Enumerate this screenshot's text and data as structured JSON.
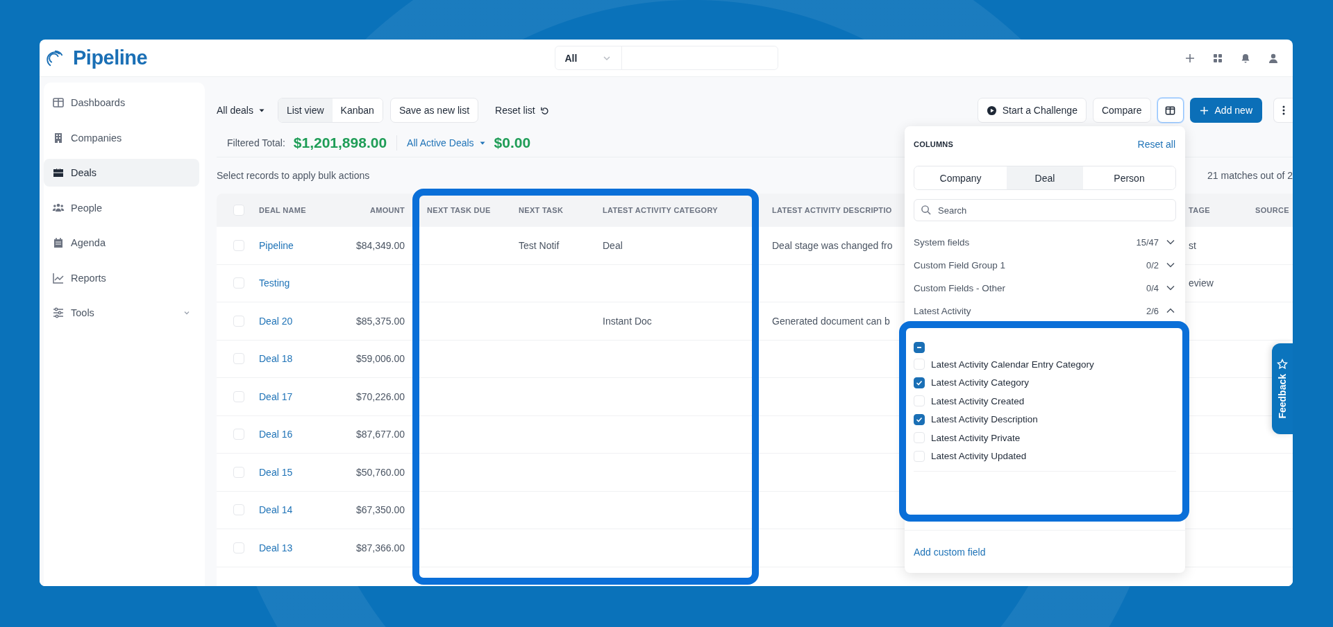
{
  "header": {
    "logo": "Pipeline",
    "search": {
      "scope": "All"
    }
  },
  "sidebar": {
    "items": [
      {
        "label": "Dashboards",
        "selected": false
      },
      {
        "label": "Companies",
        "selected": false
      },
      {
        "label": "Deals",
        "selected": true
      },
      {
        "label": "People",
        "selected": false
      },
      {
        "label": "Agenda",
        "selected": false
      },
      {
        "label": "Reports",
        "selected": false
      },
      {
        "label": "Tools",
        "selected": false,
        "expanded": false
      }
    ]
  },
  "toolbar": {
    "list_menu": "All deals",
    "views": [
      {
        "label": "List view",
        "selected": true
      },
      {
        "label": "Kanban",
        "selected": false
      }
    ],
    "save_button": "Save as new list",
    "reset_button": "Reset list",
    "challenge_button": "Start a Challenge",
    "compare_button": "Compare",
    "columns_toggle": {
      "active": true
    },
    "add_button": "Add new"
  },
  "summary": {
    "label": "Filtered Total:",
    "total": "$1,201,898.00",
    "filter": "All Active Deals",
    "filter_total": "$0.00"
  },
  "bulk_hint": "Select records to apply bulk actions",
  "match_count": "21 matches out of 2",
  "table": {
    "all_checked": false,
    "columns": [
      "DEAL NAME",
      "AMOUNT",
      "NEXT TASK DUE",
      "NEXT TASK",
      "LATEST ACTIVITY CATEGORY",
      "LATEST ACTIVITY DESCRIPTIO",
      "TAGE",
      "SOURCE"
    ],
    "rows": [
      {
        "selected": false,
        "name": "Pipeline",
        "amount": "$84,349.00",
        "next_task": "Test Notif",
        "category": "Deal",
        "description": "Deal stage was changed fro",
        "stage": "st"
      },
      {
        "selected": false,
        "name": "Testing",
        "stage": "eview"
      },
      {
        "selected": false,
        "name": "Deal 20",
        "amount": "$85,375.00",
        "category": "Instant Doc",
        "description": "Generated document can b"
      },
      {
        "selected": false,
        "name": "Deal 18",
        "amount": "$59,006.00"
      },
      {
        "selected": false,
        "name": "Deal 17",
        "amount": "$70,226.00"
      },
      {
        "selected": false,
        "name": "Deal 16",
        "amount": "$87,677.00"
      },
      {
        "selected": false,
        "name": "Deal 15",
        "amount": "$50,760.00"
      },
      {
        "selected": false,
        "name": "Deal 14",
        "amount": "$67,350.00"
      },
      {
        "selected": false,
        "name": "Deal 13",
        "amount": "$87,366.00"
      }
    ]
  },
  "columns_panel": {
    "title": "COLUMNS",
    "reset": "Reset all",
    "tabs": [
      {
        "label": "Company",
        "selected": false
      },
      {
        "label": "Deal",
        "selected": true
      },
      {
        "label": "Person",
        "selected": false
      }
    ],
    "search": {
      "placeholder": "Search"
    },
    "groups": [
      {
        "name": "System fields",
        "count": "15/47",
        "expanded": false
      },
      {
        "name": "Custom Field Group 1",
        "count": "0/2",
        "expanded": false
      },
      {
        "name": "Custom Fields - Other",
        "count": "0/4",
        "expanded": false
      },
      {
        "name": "Latest Activity",
        "count": "2/6",
        "expanded": true,
        "select_all_mixed": true,
        "options": [
          {
            "label": "Latest Activity Calendar Entry Category",
            "checked": false
          },
          {
            "label": "Latest Activity Category",
            "checked": true
          },
          {
            "label": "Latest Activity Created",
            "checked": false
          },
          {
            "label": "Latest Activity Description",
            "checked": true
          },
          {
            "label": "Latest Activity Private",
            "checked": false
          },
          {
            "label": "Latest Activity Updated",
            "checked": false
          }
        ]
      }
    ],
    "add_field": "Add custom field"
  },
  "feedback": "Feedback"
}
